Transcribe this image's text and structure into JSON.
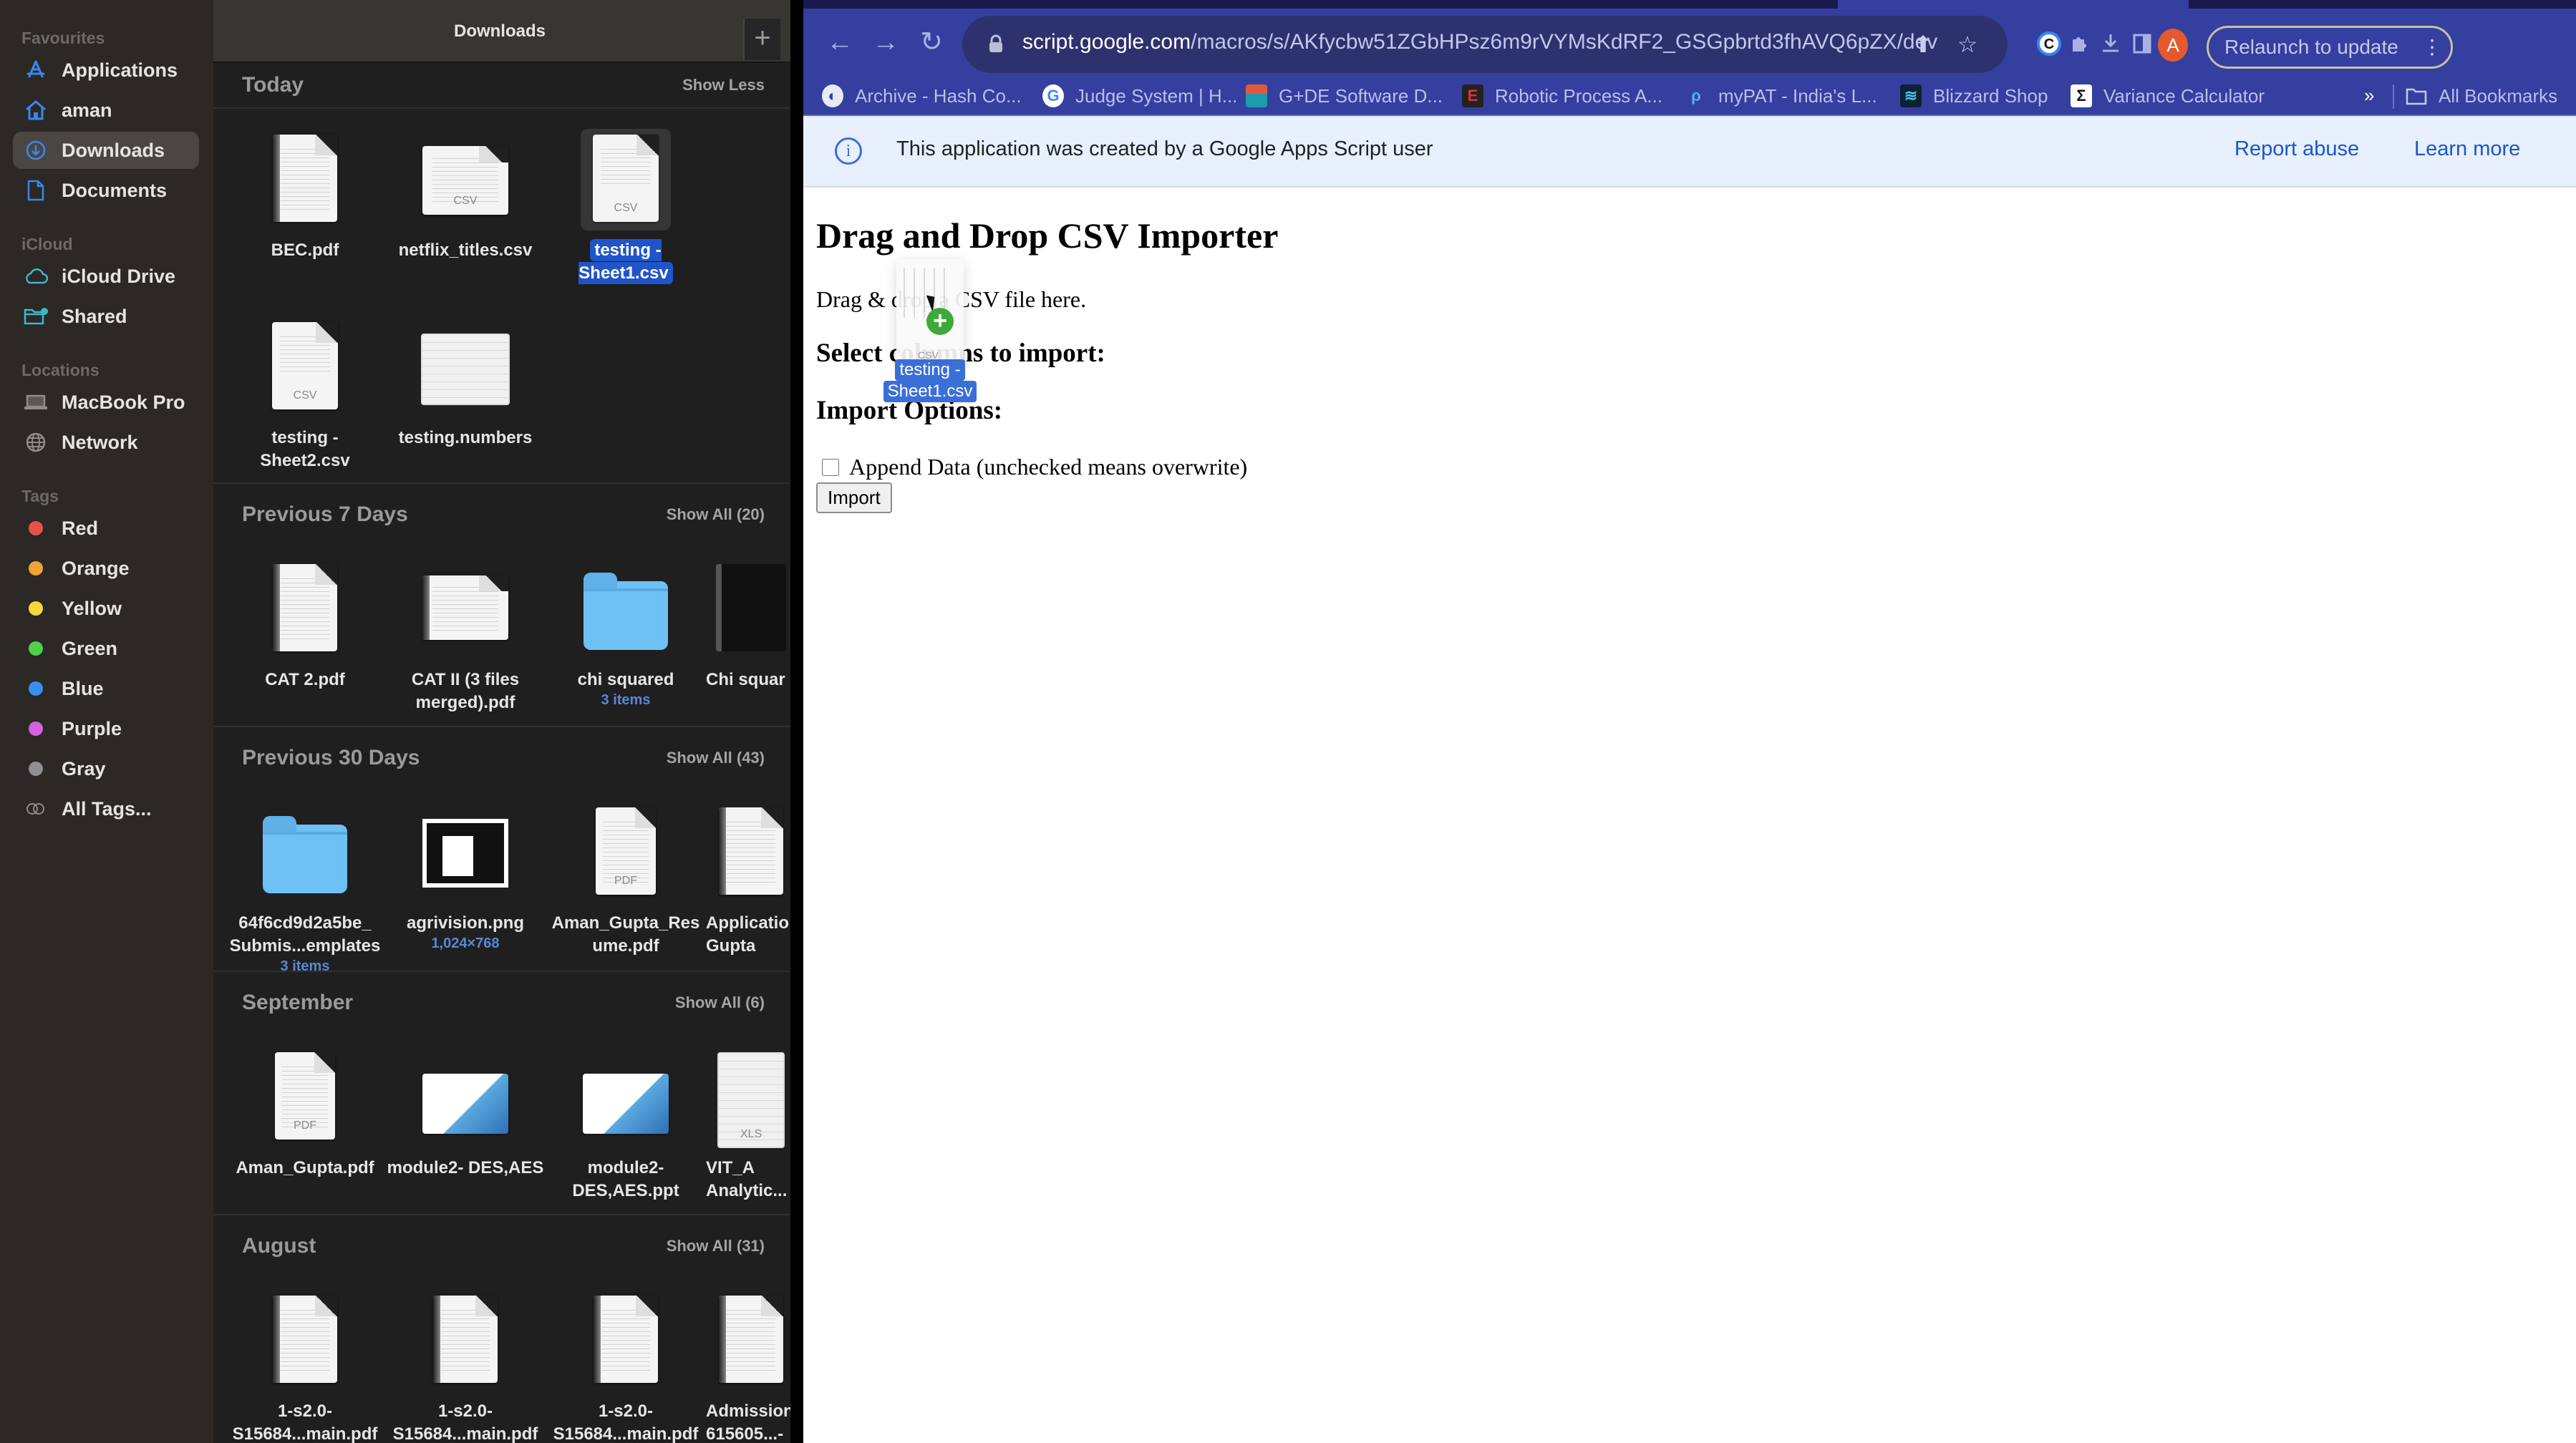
{
  "finder": {
    "title": "Downloads",
    "new_tab_label": "+",
    "sidebar": {
      "sections": [
        {
          "label": "Favourites",
          "items": [
            {
              "label": "Applications",
              "icon": "applications-icon"
            },
            {
              "label": "aman",
              "icon": "home-icon"
            },
            {
              "label": "Downloads",
              "icon": "downloads-icon",
              "active": true
            },
            {
              "label": "Documents",
              "icon": "documents-icon"
            }
          ]
        },
        {
          "label": "iCloud",
          "items": [
            {
              "label": "iCloud Drive",
              "icon": "icloud-icon"
            },
            {
              "label": "Shared",
              "icon": "shared-folder-icon"
            }
          ]
        },
        {
          "label": "Locations",
          "items": [
            {
              "label": "MacBook Pro",
              "icon": "laptop-icon"
            },
            {
              "label": "Network",
              "icon": "globe-icon"
            }
          ]
        },
        {
          "label": "Tags",
          "items": [
            {
              "label": "Red",
              "color": "#e5534b"
            },
            {
              "label": "Orange",
              "color": "#f0a33a"
            },
            {
              "label": "Yellow",
              "color": "#f4d93c"
            },
            {
              "label": "Green",
              "color": "#4fcf4a"
            },
            {
              "label": "Blue",
              "color": "#3a8ef0"
            },
            {
              "label": "Purple",
              "color": "#d462e0"
            },
            {
              "label": "Gray",
              "color": "#8e8e93"
            },
            {
              "label": "All Tags...",
              "icon": "all-tags-icon"
            }
          ]
        }
      ]
    },
    "groups": [
      {
        "title": "Today",
        "action": "Show Less",
        "files": [
          {
            "name": "BEC.pdf",
            "kind": "pdf"
          },
          {
            "name": "netflix_titles.csv",
            "kind": "csv-wide",
            "ext": "CSV"
          },
          {
            "name": "testing - Sheet1.csv",
            "kind": "csv",
            "ext": "CSV",
            "selected": true
          },
          {
            "name": "testing - Sheet2.csv",
            "kind": "csv",
            "ext": "CSV"
          },
          {
            "name": "testing.numbers",
            "kind": "numbers"
          }
        ]
      },
      {
        "title": "Previous 7 Days",
        "action": "Show All (20)",
        "files": [
          {
            "name": "CAT 2.pdf",
            "kind": "pdf"
          },
          {
            "name": "CAT II (3 files merged).pdf",
            "kind": "pdf-wide"
          },
          {
            "name": "chi squared",
            "kind": "folder",
            "sub": "3 items"
          },
          {
            "name": "Chi squar",
            "kind": "dark-doc"
          }
        ]
      },
      {
        "title": "Previous 30 Days",
        "action": "Show All (43)",
        "files": [
          {
            "name": "64f6cd9d2a5be_ Submis...emplates",
            "kind": "folder",
            "sub": "3 items"
          },
          {
            "name": "agrivision.png",
            "kind": "image",
            "sub": "1,024×768"
          },
          {
            "name": "Aman_Gupta_Res ume.pdf",
            "kind": "doc",
            "ext": "PDF"
          },
          {
            "name": "Applicatio Gupta",
            "kind": "pdf"
          }
        ]
      },
      {
        "title": "September",
        "action": "Show All (6)",
        "files": [
          {
            "name": "Aman_Gupta.pdf",
            "kind": "doc",
            "ext": "PDF"
          },
          {
            "name": "module2- DES,AES",
            "kind": "slide"
          },
          {
            "name": "module2- DES,AES.ppt",
            "kind": "slide"
          },
          {
            "name": "VIT_A Analytic...",
            "kind": "xls",
            "ext": "XLS"
          }
        ]
      },
      {
        "title": "August",
        "action": "Show All (31)",
        "files": [
          {
            "name": "1-s2.0- S15684...main.pdf",
            "kind": "pdf"
          },
          {
            "name": "1-s2.0- S15684...main.pdf",
            "kind": "pdf"
          },
          {
            "name": "1-s2.0- S15684...main.pdf",
            "kind": "pdf"
          },
          {
            "name": "Admission 615605...-",
            "kind": "pdf"
          }
        ]
      }
    ]
  },
  "browser": {
    "url_host": "script.google.com",
    "url_path": "/macros/s/AKfycbw51ZGbHPsz6m9rVYMsKdRF2_GSGpbrtd3fhAVQ6pZX/dev",
    "avatar_letter": "A",
    "relaunch_label": "Relaunch to update",
    "bookmarks": [
      {
        "label": "Archive - Hash Co...",
        "icon": "globe-icon"
      },
      {
        "label": "Judge System | H...",
        "icon": "google-icon"
      },
      {
        "label": "G+DE Software D...",
        "icon": "gde-icon"
      },
      {
        "label": "Robotic Process A...",
        "icon": "e-icon"
      },
      {
        "label": "myPAT - India's L...",
        "icon": "mypat-icon"
      },
      {
        "label": "Blizzard Shop",
        "icon": "blizzard-icon"
      },
      {
        "label": "Variance Calculator",
        "icon": "sigma-icon"
      }
    ],
    "overflow_label": "»",
    "all_bookmarks_label": "All Bookmarks",
    "infobar": {
      "message": "This application was created by a Google Apps Script user",
      "report_abuse": "Report abuse",
      "learn_more": "Learn more"
    },
    "page": {
      "title": "Drag and Drop CSV Importer",
      "drop_text": "Drag & drop a CSV file here.",
      "select_columns_heading": "Select columns to import:",
      "import_options_heading": "Import Options:",
      "append_label": "Append Data (unchecked means overwrite)",
      "append_checked": false,
      "import_button": "Import"
    },
    "drag_ghost": {
      "label_line1": "testing -",
      "label_line2": "Sheet1.csv",
      "ext": "CSV"
    }
  }
}
